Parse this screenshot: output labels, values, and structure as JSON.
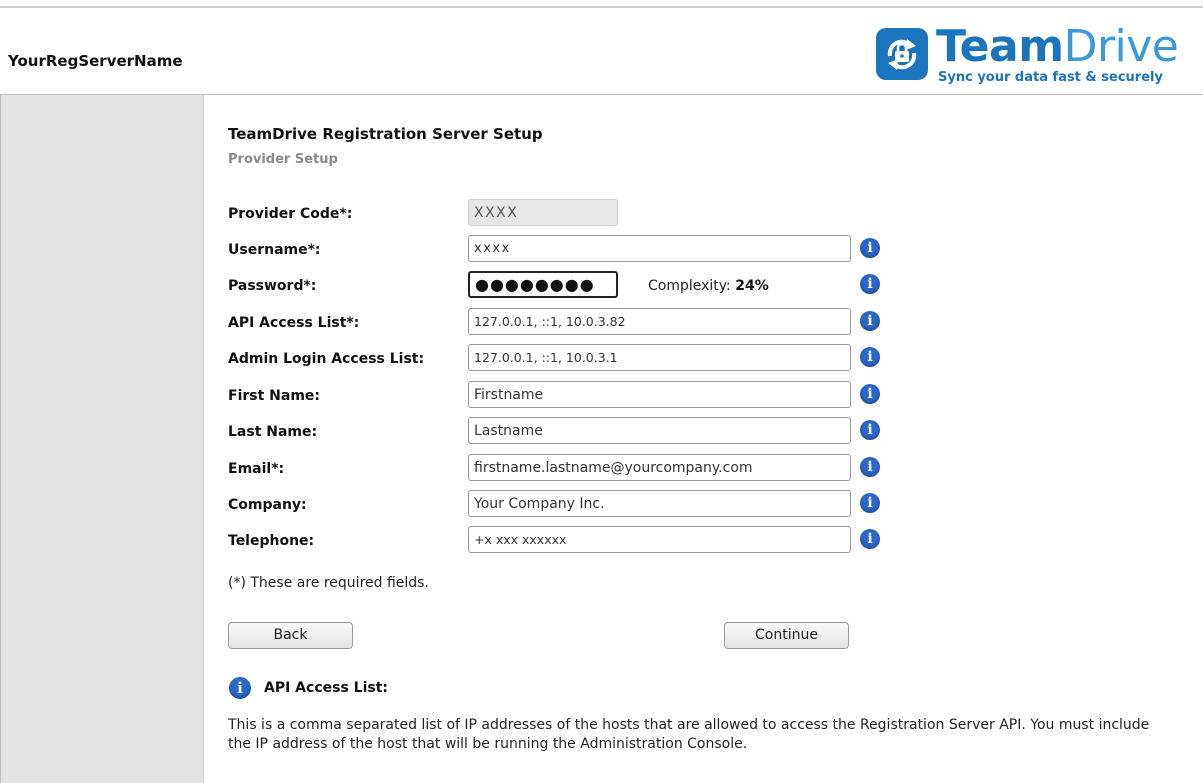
{
  "header": {
    "server_name": "YourRegServerName",
    "logo_word_team": "Team",
    "logo_word_drive": "Drive",
    "logo_tagline": "Sync your data fast & securely"
  },
  "page": {
    "title": "TeamDrive Registration Server Setup",
    "subtitle": "Provider Setup"
  },
  "form": {
    "provider_code": {
      "label": "Provider Code*:",
      "value": "XXXX"
    },
    "username": {
      "label": "Username*:",
      "value": "xxxx"
    },
    "password": {
      "label": "Password*:",
      "value": "●●●●●●●●",
      "complexity_label": "Complexity:",
      "complexity_value": "24%"
    },
    "api_access_list": {
      "label": "API Access List*:",
      "value": "127.0.0.1, ::1, 10.0.3.82"
    },
    "admin_login_access_list": {
      "label": "Admin Login Access List:",
      "value": "127.0.0.1, ::1, 10.0.3.1"
    },
    "first_name": {
      "label": "First Name:",
      "value": "Firstname"
    },
    "last_name": {
      "label": "Last Name:",
      "value": "Lastname"
    },
    "email": {
      "label": "Email*:",
      "value": "firstname.lastname@yourcompany.com"
    },
    "company": {
      "label": "Company:",
      "value": "Your Company Inc."
    },
    "telephone": {
      "label": "Telephone:",
      "value": "+x xxx xxxxxx"
    },
    "required_note": "(*) These are required fields."
  },
  "buttons": {
    "back": "Back",
    "continue": "Continue"
  },
  "help": {
    "icon_glyph": "i",
    "title": "API Access List:",
    "text": "This is a comma separated list of IP addresses of the hosts that are allowed to access the Registration Server API. You must include the IP address of the host that will be running the Administration Console."
  },
  "colors": {
    "brand_blue": "#1b75bc",
    "info_blue": "#2a67c9",
    "sidebar_gray": "#e3e3e3"
  },
  "icons": {
    "info": "info-icon",
    "logo": "teamdrive-lock-sync-icon"
  }
}
